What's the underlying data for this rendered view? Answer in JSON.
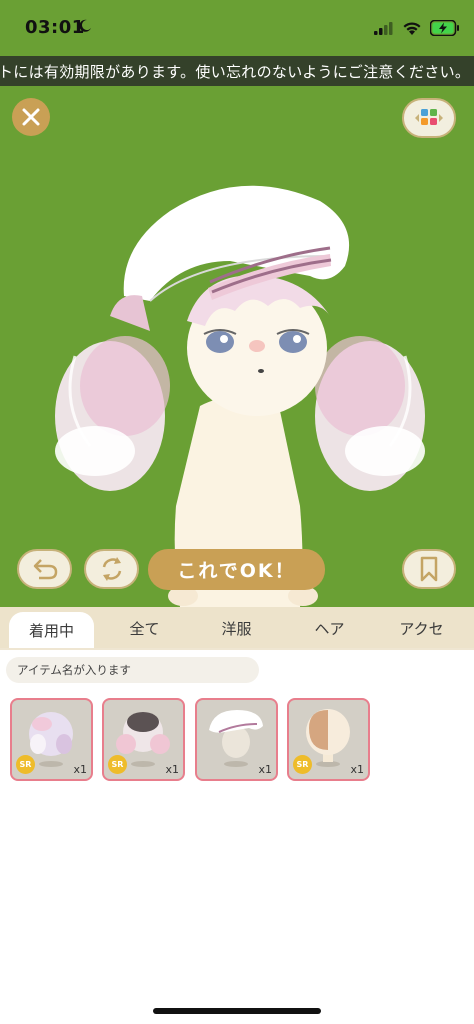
{
  "status_bar": {
    "time": "03:01",
    "battery_color": "#43d34a"
  },
  "notice": {
    "text": "トには有効期限があります。使い忘れのないようにご注意ください。"
  },
  "controls": {
    "ok_label": "これでOK！"
  },
  "tabs": [
    {
      "label": "着用中",
      "active": true
    },
    {
      "label": "全て",
      "active": false
    },
    {
      "label": "洋服",
      "active": false
    },
    {
      "label": "ヘア",
      "active": false
    },
    {
      "label": "アクセ",
      "active": false
    }
  ],
  "search": {
    "placeholder": "アイテム名が入ります"
  },
  "items": [
    {
      "rarity": "SR",
      "quantity": "x1"
    },
    {
      "rarity": "SR",
      "quantity": "x1"
    },
    {
      "rarity": "",
      "quantity": "x1"
    },
    {
      "rarity": "SR",
      "quantity": "x1"
    }
  ],
  "colors": {
    "stage_bg": "#6aa034",
    "accent_gold": "#c9a055",
    "tab_bg": "#ede3cb",
    "item_border": "#e87e8c",
    "sr_badge": "#eebc2a"
  }
}
